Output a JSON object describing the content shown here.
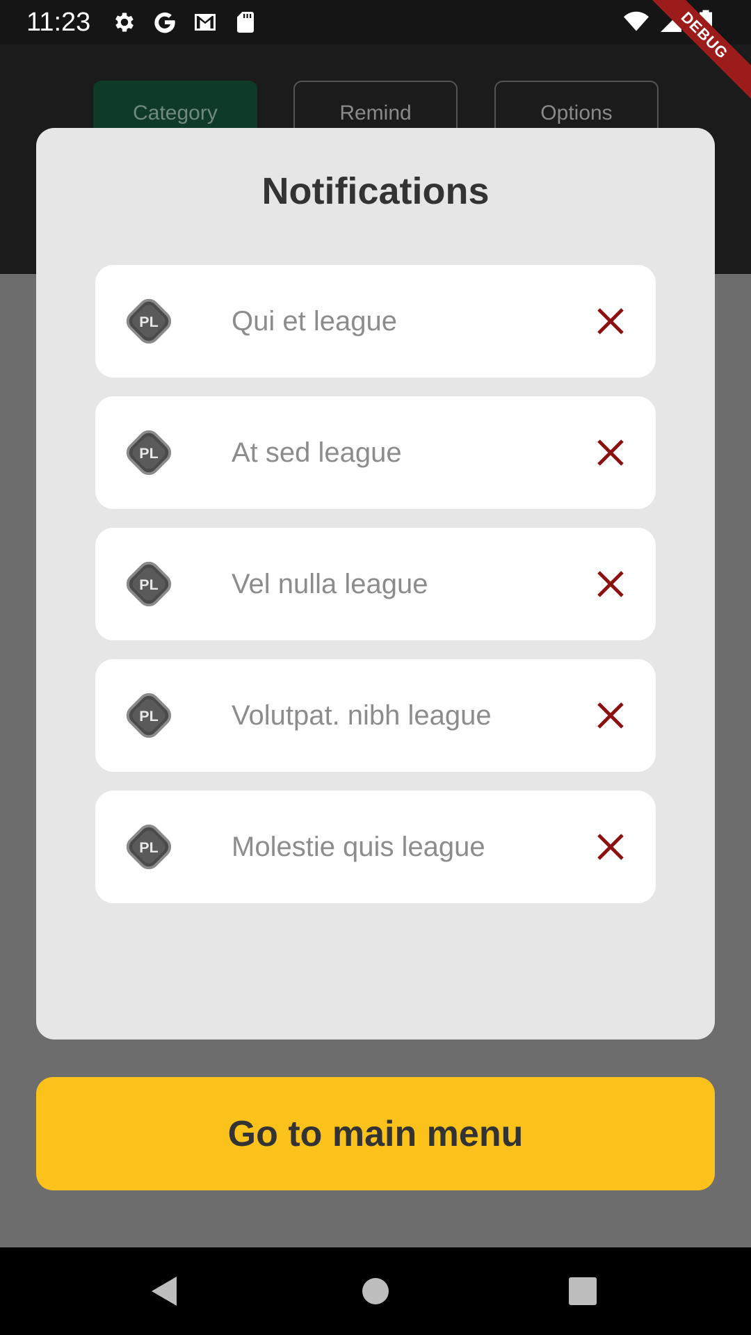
{
  "status_bar": {
    "time": "11:23",
    "left_icons": [
      "gear-icon",
      "google-icon",
      "gmail-icon",
      "sd-card-icon"
    ],
    "right_icons": [
      "wifi-icon",
      "signal-icon",
      "battery-icon"
    ]
  },
  "debug_banner": "DEBUG",
  "tabs": [
    {
      "label": "Category",
      "active": true
    },
    {
      "label": "Remind",
      "active": false
    },
    {
      "label": "Options",
      "active": false
    }
  ],
  "dialog": {
    "title": "Notifications",
    "items": [
      {
        "badge": "PL",
        "label": "Qui et league",
        "remove_icon": "close-icon"
      },
      {
        "badge": "PL",
        "label": "At sed league",
        "remove_icon": "close-icon"
      },
      {
        "badge": "PL",
        "label": "Vel nulla league",
        "remove_icon": "close-icon"
      },
      {
        "badge": "PL",
        "label": "Volutpat. nibh league",
        "remove_icon": "close-icon"
      },
      {
        "badge": "PL",
        "label": "Molestie quis league",
        "remove_icon": "close-icon"
      }
    ]
  },
  "main_menu_button": {
    "label": "Go to main menu"
  },
  "colors": {
    "accent_button": "#fbc21c",
    "active_tab": "#0f3a28",
    "remove_icon": "#8b1010",
    "dialog_background": "#e6e6e6"
  },
  "nav_bar": [
    "back-icon",
    "home-icon",
    "recents-icon"
  ]
}
